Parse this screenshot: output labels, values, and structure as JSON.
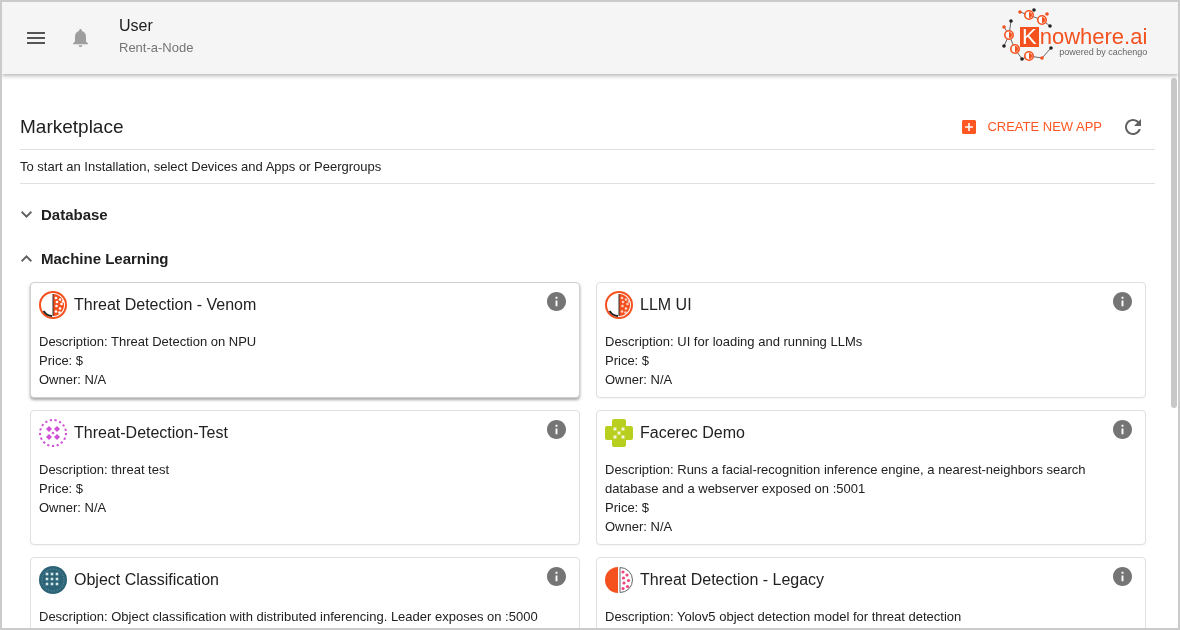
{
  "header": {
    "user": {
      "name": "User",
      "subtitle": "Rent-a-Node"
    },
    "logo": {
      "initial": "K",
      "wordmark": "nowhere.ai",
      "tagline": "powered by cachengo"
    }
  },
  "marketplace": {
    "title": "Marketplace",
    "create_button": "CREATE NEW APP",
    "hint": "To start an Installation, select Devices and Apps or Peergroups"
  },
  "categories": [
    {
      "title": "Database",
      "expanded": false
    },
    {
      "title": "Machine Learning",
      "expanded": true,
      "apps": [
        {
          "name": "Threat Detection - Venom",
          "hovered": true,
          "description": "Description: Threat Detection on NPU",
          "price": "Price: $",
          "owner": "Owner: N/A"
        },
        {
          "name": "LLM UI",
          "hovered": false,
          "description": "Description: UI for loading and running LLMs",
          "price": "Price: $",
          "owner": "Owner: N/A"
        },
        {
          "name": "Threat-Detection-Test",
          "hovered": false,
          "description": "Description: threat test",
          "price": "Price: $",
          "owner": "Owner: N/A"
        },
        {
          "name": "Facerec Demo",
          "hovered": false,
          "description": "Description: Runs a facial-recognition inference engine, a nearest-neighbors search database and a webserver exposed on :5001",
          "price": "Price: $",
          "owner": "Owner: N/A"
        },
        {
          "name": "Object Classification",
          "hovered": false,
          "description": "Description: Object classification with distributed inferencing. Leader exposes on :5000"
        },
        {
          "name": "Threat Detection - Legacy",
          "hovered": false,
          "description": "Description: Yolov5 object detection model for threat detection"
        }
      ]
    }
  ]
}
